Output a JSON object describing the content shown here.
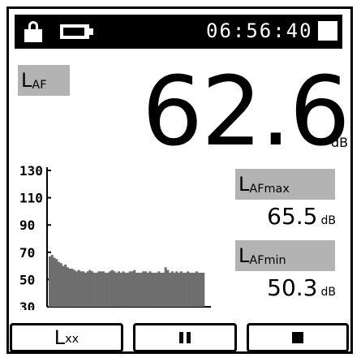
{
  "status": {
    "time": "06:56:40",
    "icons": [
      "lock-icon",
      "battery-icon",
      "stop-indicator-icon"
    ]
  },
  "main": {
    "param_label": "L",
    "param_sub": "AF",
    "value": "62.6",
    "unit": "dB"
  },
  "chart_data": {
    "type": "area",
    "y_ticks": [
      "130",
      "110",
      "90",
      "70",
      "50",
      "30"
    ],
    "ylim": [
      30,
      130
    ],
    "values": [
      67,
      68,
      66,
      65,
      63,
      62,
      60,
      61,
      59,
      58,
      58,
      57,
      56,
      57,
      56,
      56,
      55,
      56,
      57,
      56,
      55,
      55,
      56,
      56,
      56,
      55,
      55,
      56,
      57,
      56,
      55,
      56,
      55,
      56,
      55,
      55,
      56,
      56,
      57,
      55,
      55,
      55,
      56,
      56,
      55,
      56,
      55,
      55,
      55,
      56,
      55,
      55,
      59,
      57,
      55,
      56,
      55,
      56,
      55,
      56,
      55,
      55,
      56,
      55,
      55,
      55,
      56,
      55,
      55,
      55
    ],
    "colors": {
      "fill": "#6e6e6e",
      "axis": "#000000"
    }
  },
  "readings": [
    {
      "label": "L",
      "sub": "AFmax",
      "value": "65.5",
      "unit": "dB"
    },
    {
      "label": "L",
      "sub": "AFmin",
      "value": "50.3",
      "unit": "dB"
    }
  ],
  "buttons": {
    "lxx_label": "L",
    "lxx_sub": "xx",
    "pause": "pause-icon",
    "stop": "stop-icon"
  }
}
